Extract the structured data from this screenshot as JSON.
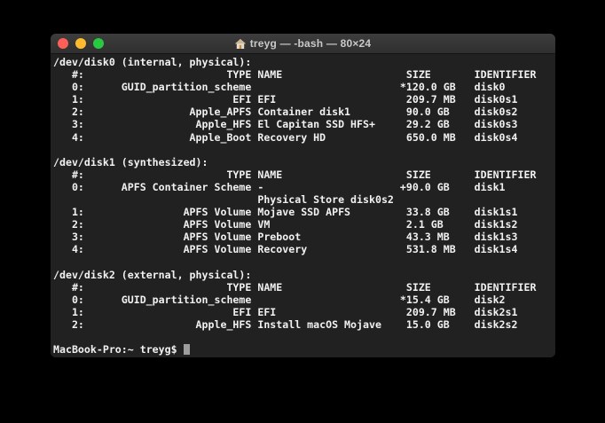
{
  "window": {
    "title": "treyg — -bash — 80×24",
    "title_icon": "home-icon",
    "traffic_lights": [
      {
        "name": "close-button",
        "color": "#ff5f57"
      },
      {
        "name": "minimize-button",
        "color": "#febc2e"
      },
      {
        "name": "zoom-button",
        "color": "#28c840"
      }
    ]
  },
  "terminal": {
    "colors": {
      "desktop_background": "#000000",
      "terminal_background": "#212121",
      "titlebar_background": "#343434",
      "text": "#f1f1f1",
      "cursor": "#9d9d9d"
    },
    "columns": [
      "#:",
      "TYPE",
      "NAME",
      "SIZE",
      "IDENTIFIER"
    ],
    "disks": [
      {
        "device": "/dev/disk0",
        "kind": "(internal, physical):",
        "rows": [
          [
            "0:",
            "GUID_partition_scheme",
            "",
            "*120.0 GB",
            "disk0"
          ],
          [
            "1:",
            "EFI",
            "EFI",
            "209.7 MB",
            "disk0s1"
          ],
          [
            "2:",
            "Apple_APFS",
            "Container disk1",
            "90.0 GB",
            "disk0s2"
          ],
          [
            "3:",
            "Apple_HFS",
            "El Capitan SSD HFS+",
            "29.2 GB",
            "disk0s3"
          ],
          [
            "4:",
            "Apple_Boot",
            "Recovery HD",
            "650.0 MB",
            "disk0s4"
          ]
        ]
      },
      {
        "device": "/dev/disk1",
        "kind": "(synthesized):",
        "rows": [
          [
            "0:",
            "APFS Container Scheme",
            "-",
            "+90.0 GB",
            "disk1"
          ],
          [
            "",
            "",
            "Physical Store disk0s2",
            "",
            ""
          ],
          [
            "1:",
            "APFS Volume",
            "Mojave SSD APFS",
            "33.8 GB",
            "disk1s1"
          ],
          [
            "2:",
            "APFS Volume",
            "VM",
            "2.1 GB",
            "disk1s2"
          ],
          [
            "3:",
            "APFS Volume",
            "Preboot",
            "43.3 MB",
            "disk1s3"
          ],
          [
            "4:",
            "APFS Volume",
            "Recovery",
            "531.8 MB",
            "disk1s4"
          ]
        ]
      },
      {
        "device": "/dev/disk2",
        "kind": "(external, physical):",
        "rows": [
          [
            "0:",
            "GUID_partition_scheme",
            "",
            "*15.4 GB",
            "disk2"
          ],
          [
            "1:",
            "EFI",
            "EFI",
            "209.7 MB",
            "disk2s1"
          ],
          [
            "2:",
            "Apple_HFS",
            "Install macOS Mojave",
            "15.0 GB",
            "disk2s2"
          ]
        ]
      }
    ],
    "lines": [
      "/dev/disk0 (internal, physical):",
      "   #:                       TYPE NAME                    SIZE       IDENTIFIER",
      "   0:      GUID_partition_scheme                        *120.0 GB   disk0",
      "   1:                        EFI EFI                     209.7 MB   disk0s1",
      "   2:                 Apple_APFS Container disk1         90.0 GB    disk0s2",
      "   3:                  Apple_HFS El Capitan SSD HFS+     29.2 GB    disk0s3",
      "   4:                 Apple_Boot Recovery HD             650.0 MB   disk0s4",
      "",
      "/dev/disk1 (synthesized):",
      "   #:                       TYPE NAME                    SIZE       IDENTIFIER",
      "   0:      APFS Container Scheme -                      +90.0 GB    disk1",
      "                                 Physical Store disk0s2",
      "   1:                APFS Volume Mojave SSD APFS         33.8 GB    disk1s1",
      "   2:                APFS Volume VM                      2.1 GB     disk1s2",
      "   3:                APFS Volume Preboot                 43.3 MB    disk1s3",
      "   4:                APFS Volume Recovery                531.8 MB   disk1s4",
      "",
      "/dev/disk2 (external, physical):",
      "   #:                       TYPE NAME                    SIZE       IDENTIFIER",
      "   0:      GUID_partition_scheme                        *15.4 GB    disk2",
      "   1:                        EFI EFI                     209.7 MB   disk2s1",
      "   2:                  Apple_HFS Install macOS Mojave    15.0 GB    disk2s2",
      ""
    ],
    "prompt": "MacBook-Pro:~ treyg$ "
  }
}
